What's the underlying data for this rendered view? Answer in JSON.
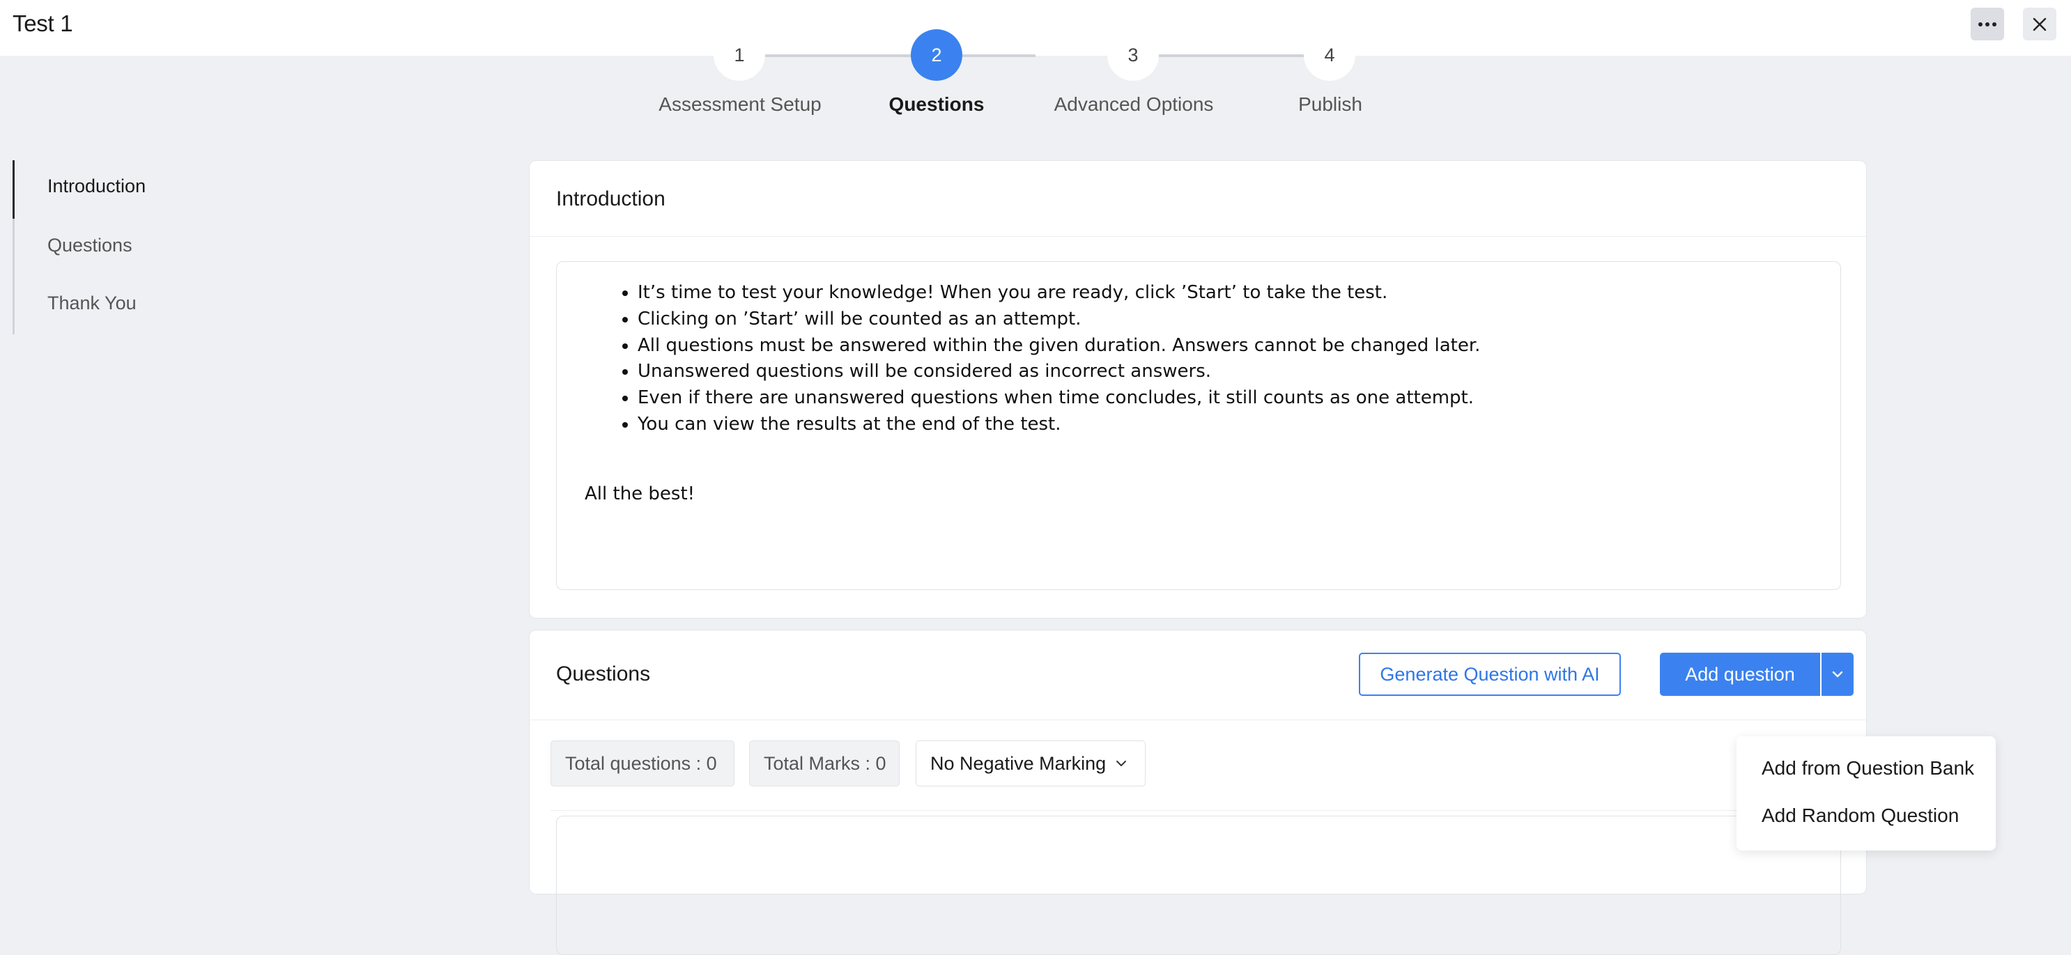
{
  "app": {
    "title": "Test 1"
  },
  "header": {
    "more_icon": "more-horizontal-icon",
    "close_icon": "close-icon"
  },
  "stepper": {
    "steps": [
      {
        "number": "1",
        "label": "Assessment Setup",
        "active": false
      },
      {
        "number": "2",
        "label": "Questions",
        "active": true
      },
      {
        "number": "3",
        "label": "Advanced Options",
        "active": false
      },
      {
        "number": "4",
        "label": "Publish",
        "active": false
      }
    ]
  },
  "sidebar": {
    "items": [
      {
        "label": "Introduction",
        "active": true
      },
      {
        "label": "Questions",
        "active": false
      },
      {
        "label": "Thank You",
        "active": false
      }
    ]
  },
  "introduction": {
    "title": "Introduction",
    "bullets": [
      "It’s time to test your knowledge! When you are ready, click ’Start’ to take the test.",
      "Clicking on ’Start’ will be counted as an attempt.",
      "All questions must be answered within the given duration. Answers cannot be changed later.",
      "Unanswered questions will be considered as incorrect answers.",
      "Even if there are unanswered questions when time concludes, it still counts as one attempt.",
      "You can view the results at the end of the test."
    ],
    "closing": "All the best!"
  },
  "questions": {
    "title": "Questions",
    "generate_button": "Generate Question with AI",
    "add_button": "Add question",
    "total_questions": "Total questions : 0",
    "total_marks": "Total Marks : 0",
    "negative_marking": "No Negative Marking"
  },
  "add_menu": {
    "items": [
      "Add from Question Bank",
      "Add Random Question"
    ]
  },
  "colors": {
    "accent": "#3b82f0",
    "background": "#eef0f3"
  }
}
